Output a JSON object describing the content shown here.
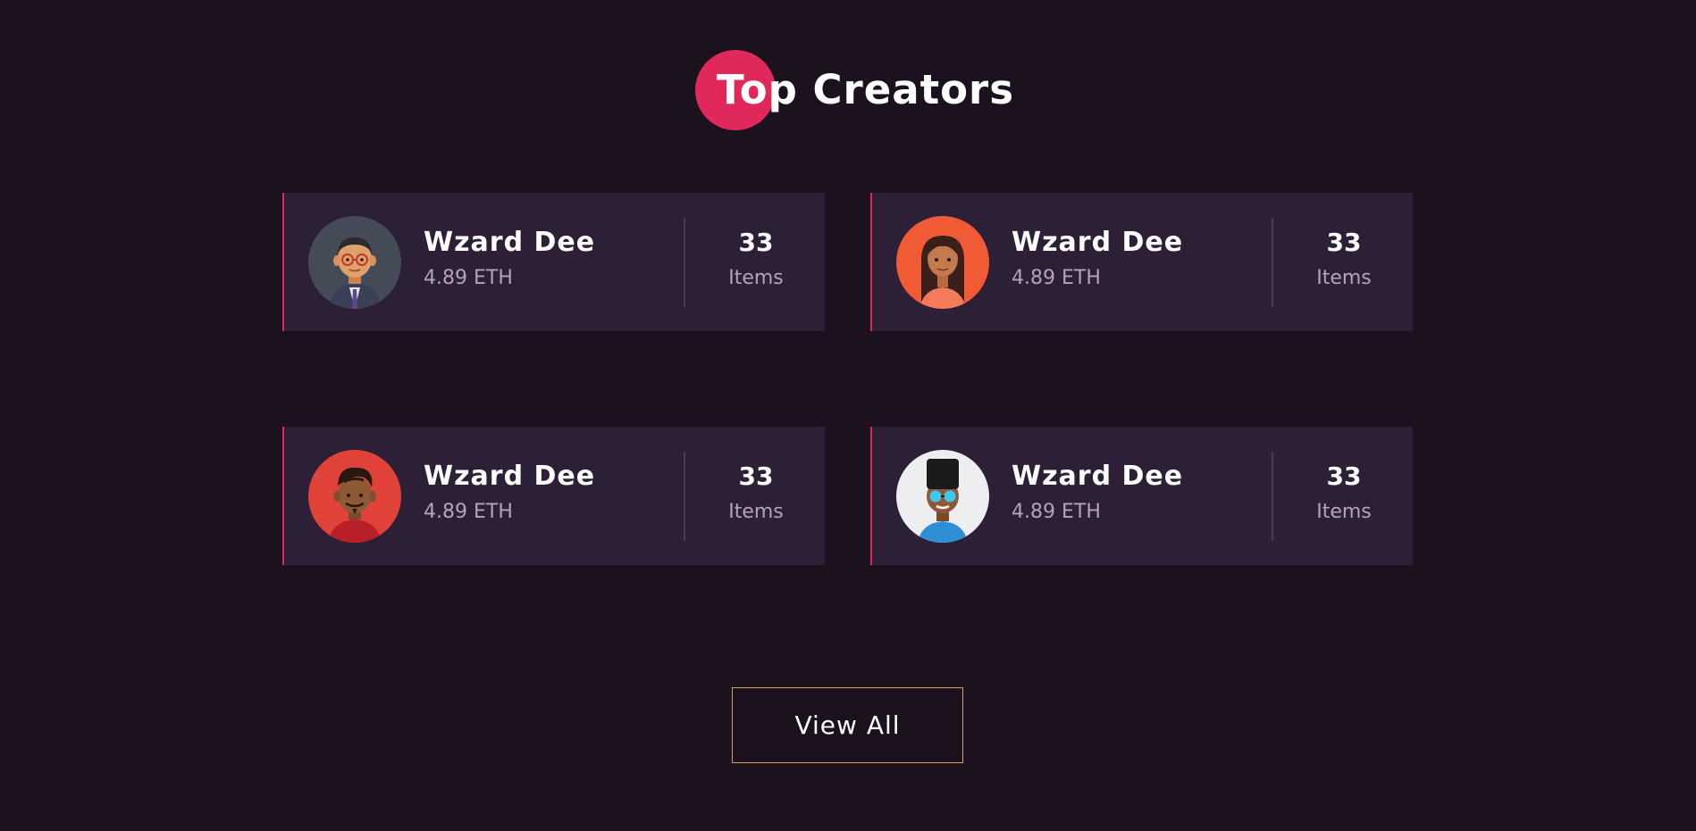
{
  "section": {
    "title": "Top Creators",
    "accent_color": "#e0295a"
  },
  "creators": [
    {
      "name": "Wzard Dee",
      "price": "4.89 ETH",
      "count": "33",
      "count_label": "Items",
      "avatar_icon": "avatar-glasses-suit-icon",
      "avatar_bg": "#454a57"
    },
    {
      "name": "Wzard Dee",
      "price": "4.89 ETH",
      "count": "33",
      "count_label": "Items",
      "avatar_icon": "avatar-long-hair-icon",
      "avatar_bg": "#f05a35"
    },
    {
      "name": "Wzard Dee",
      "price": "4.89 ETH",
      "count": "33",
      "count_label": "Items",
      "avatar_icon": "avatar-beard-icon",
      "avatar_bg": "#e0423a"
    },
    {
      "name": "Wzard Dee",
      "price": "4.89 ETH",
      "count": "33",
      "count_label": "Items",
      "avatar_icon": "avatar-sunglasses-icon",
      "avatar_bg": "#eeeef1"
    }
  ],
  "view_all": {
    "label": "View All",
    "border_color": "#d9a24a"
  }
}
